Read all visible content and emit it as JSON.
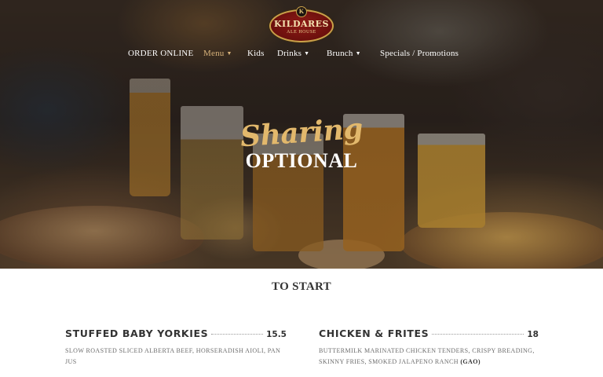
{
  "brand": {
    "logo_letter": "K",
    "name": "KILDARES",
    "subtitle": "ALE HOUSE"
  },
  "nav": [
    {
      "label": "ORDER ONLINE",
      "has_dropdown": false,
      "active": false
    },
    {
      "label": "Menu",
      "has_dropdown": true,
      "active": true
    },
    {
      "label": "Kids",
      "has_dropdown": false,
      "active": false
    },
    {
      "label": "Drinks",
      "has_dropdown": true,
      "active": false
    },
    {
      "label": "Brunch",
      "has_dropdown": true,
      "active": false
    },
    {
      "label": "Specials / Promotions",
      "has_dropdown": false,
      "active": false
    }
  ],
  "hero": {
    "script_text": "Sharing",
    "title": "OPTIONAL"
  },
  "section": {
    "title": "TO START"
  },
  "items": [
    {
      "name": "STUFFED BABY YORKIES",
      "price": "15.5",
      "description": "SLOW ROASTED SLICED ALBERTA BEEF, HORSERADISH AIOLI, PAN JUS"
    },
    {
      "name": "CHICKEN & FRITES",
      "price": "18",
      "description": "BUTTERMILK MARINATED CHICKEN TENDERS, CRISPY BREADING, SKINNY FRIES, SMOKED JALAPENO RANCH",
      "tag": "(GAO)"
    }
  ],
  "colors": {
    "accent_gold": "#d7b27a",
    "logo_red": "#8e1a16",
    "script_gold": "#e2b86c",
    "text_dark": "#333333"
  },
  "icons": {
    "caret": "chevron-down-icon"
  }
}
